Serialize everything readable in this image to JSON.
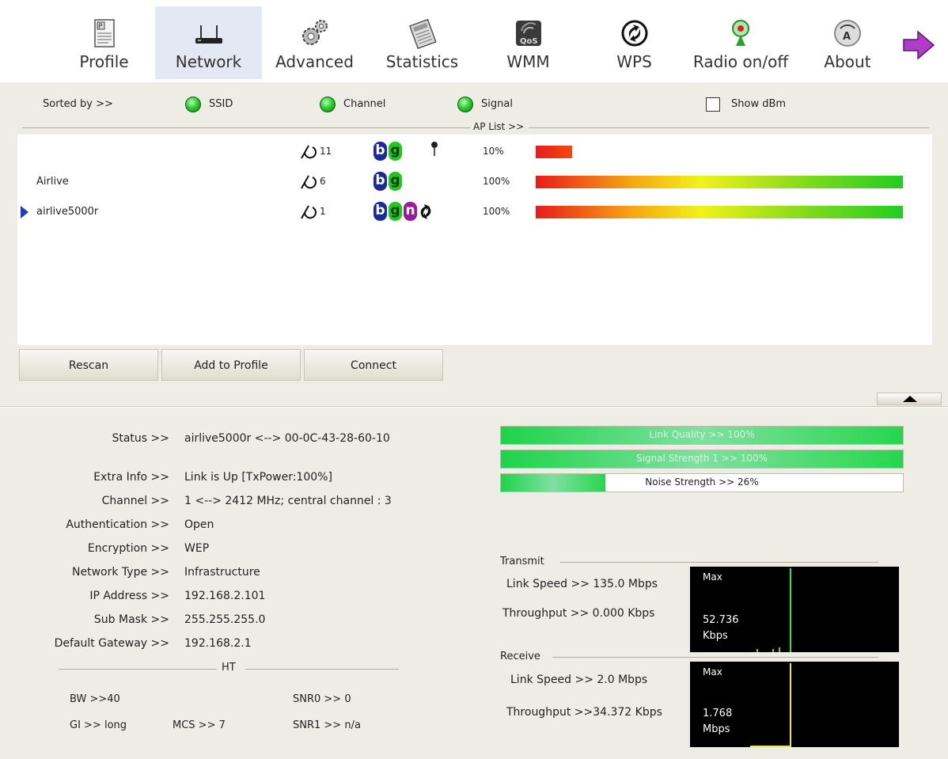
{
  "toolbar": {
    "items": [
      {
        "label": "Profile",
        "icon": "profile-icon"
      },
      {
        "label": "Network",
        "icon": "network-icon",
        "active": true
      },
      {
        "label": "Advanced",
        "icon": "gears-icon"
      },
      {
        "label": "Statistics",
        "icon": "statistics-icon"
      },
      {
        "label": "WMM",
        "icon": "qos-icon"
      },
      {
        "label": "WPS",
        "icon": "wps-icon"
      },
      {
        "label": "Radio on/off",
        "icon": "radio-icon"
      },
      {
        "label": "About",
        "icon": "about-icon"
      }
    ],
    "next_icon": "arrow-right-icon"
  },
  "sort": {
    "label": "Sorted by >>",
    "options": [
      "SSID",
      "Channel",
      "Signal"
    ],
    "show_dbm_label": "Show dBm",
    "show_dbm_checked": false
  },
  "ap_list": {
    "title": "AP List >>",
    "rows": [
      {
        "ssid": "",
        "channel": "11",
        "modes": [
          "b",
          "g"
        ],
        "locked": true,
        "wps": false,
        "signal_text": "10%",
        "signal": 10,
        "selected": false
      },
      {
        "ssid": "Airlive",
        "channel": "6",
        "modes": [
          "b",
          "g"
        ],
        "locked": false,
        "wps": false,
        "signal_text": "100%",
        "signal": 100,
        "selected": false
      },
      {
        "ssid": "airlive5000r",
        "channel": "1",
        "modes": [
          "b",
          "g",
          "n"
        ],
        "locked": false,
        "wps": true,
        "signal_text": "100%",
        "signal": 100,
        "selected": true
      }
    ]
  },
  "buttons": {
    "rescan": "Rescan",
    "add_to_profile": "Add to Profile",
    "connect": "Connect"
  },
  "info": {
    "status_label": "Status >>",
    "status": "airlive5000r <--> 00-0C-43-28-60-10",
    "extra_info_label": "Extra Info >>",
    "extra_info": "Link is Up [TxPower:100%]",
    "channel_label": "Channel >>",
    "channel": "1 <--> 2412 MHz; central channel : 3",
    "auth_label": "Authentication >>",
    "auth": "Open",
    "encryption_label": "Encryption >>",
    "encryption": "WEP",
    "network_type_label": "Network Type >>",
    "network_type": "Infrastructure",
    "ip_label": "IP Address >>",
    "ip": "192.168.2.101",
    "mask_label": "Sub Mask >>",
    "mask": "255.255.255.0",
    "gateway_label": "Default Gateway >>",
    "gateway": "192.168.2.1"
  },
  "ht": {
    "title": "HT",
    "bw": "BW >>40",
    "gi": "GI >> long",
    "mcs": "MCS >>  7",
    "snr0": "SNR0 >>  0",
    "snr1": "SNR1 >> n/a"
  },
  "quality": {
    "link_quality_text": "Link Quality >> 100%",
    "link_quality": 100,
    "signal_strength_text": "Signal Strength 1 >> 100%",
    "signal_strength": 100,
    "noise_strength_text": "Noise Strength >> 26%",
    "noise_strength": 26
  },
  "transmit": {
    "title": "Transmit",
    "link_speed": "Link Speed >>  135.0 Mbps",
    "throughput": "Throughput >> 0.000 Kbps",
    "graph_max": "Max",
    "graph_value": "52.736",
    "graph_unit": "Kbps",
    "graph_color": "#3adf3a"
  },
  "receive": {
    "title": "Receive",
    "link_speed": "Link Speed >> 2.0 Mbps",
    "throughput": "Throughput >>34.372 Kbps",
    "graph_max": "Max",
    "graph_value": "1.768",
    "graph_unit": "Mbps",
    "graph_color": "#f2e23a"
  }
}
